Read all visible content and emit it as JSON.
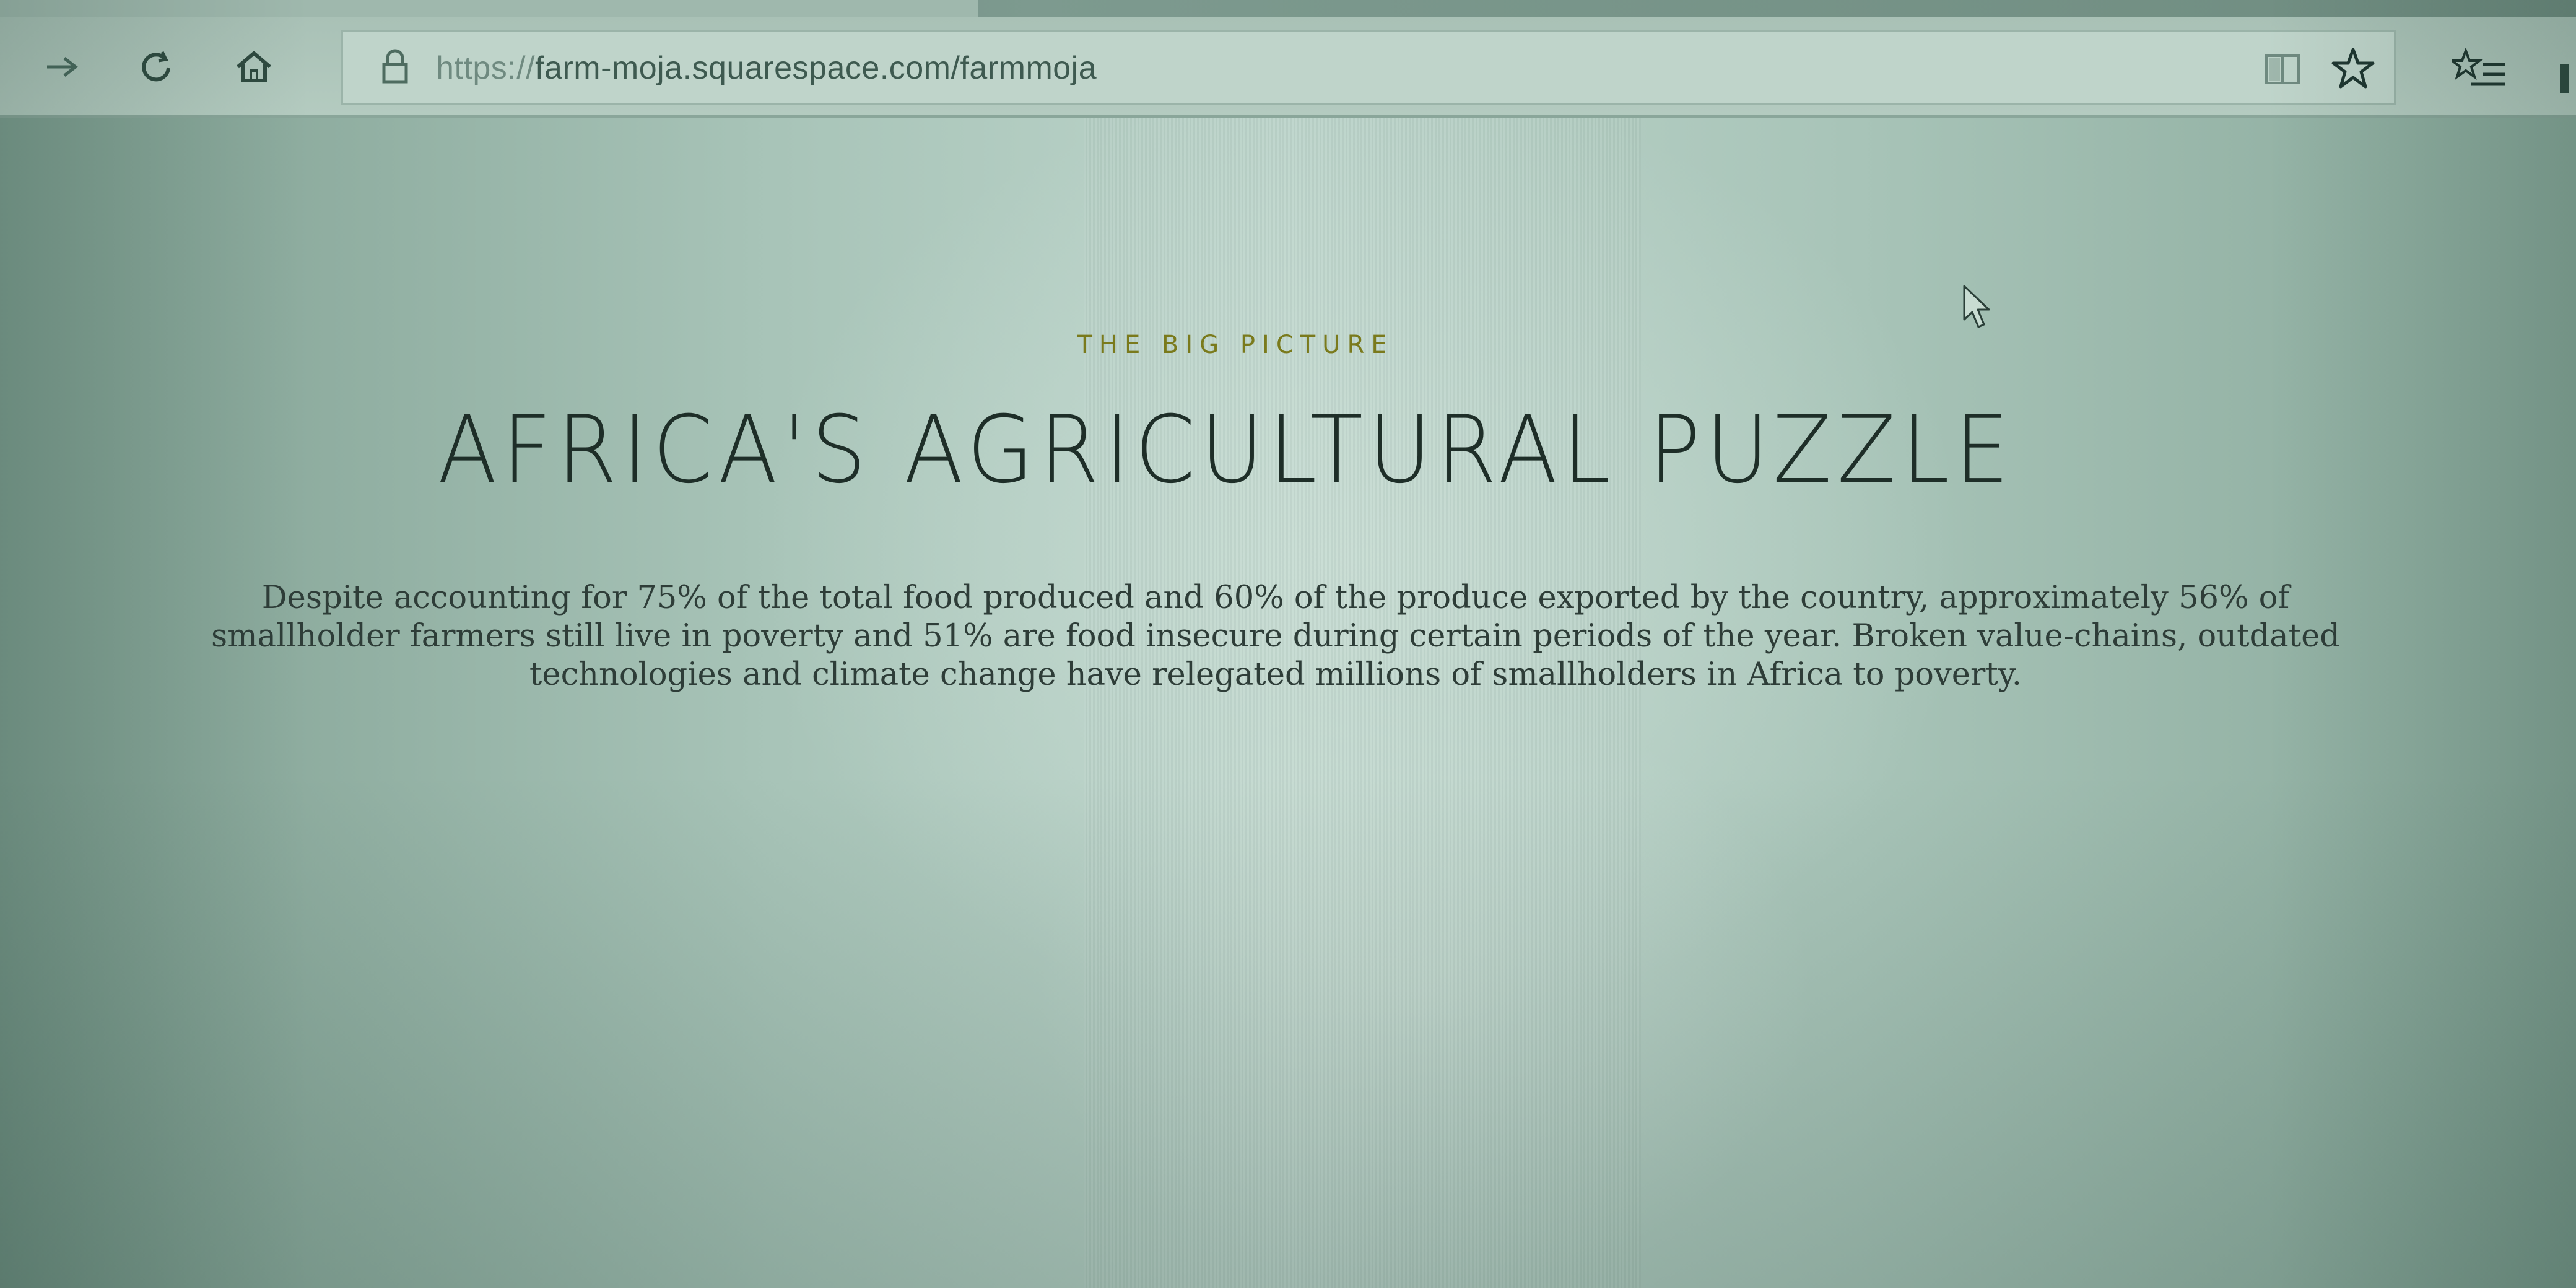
{
  "browser": {
    "url_scheme": "https://",
    "url_rest": "farm-moja.squarespace.com/farmmoja",
    "icons": {
      "forward": "forward-arrow-icon",
      "refresh": "refresh-icon",
      "home": "home-icon",
      "lock": "lock-icon",
      "reading_view": "reading-view-icon",
      "favorite": "star-icon",
      "favorites_hub": "favorites-hub-icon"
    }
  },
  "page": {
    "eyebrow": "THE BIG PICTURE",
    "headline": "AFRICA'S AGRICULTURAL PUZZLE",
    "body_line1": "Despite accounting for 75% of the total food produced and 60% of the produce exported by the country, approximately 56% of",
    "body_line2": "smallholder farmers still live in poverty and 51% are food insecure during certain periods of the year. Broken value-chains, outdated",
    "body_line3": "technologies and climate change have relegated millions of smallholders in Africa to poverty."
  },
  "colors": {
    "eyebrow": "#7a7a1c",
    "headline": "#1e2e28",
    "body": "#2e3d38",
    "screen_tint": "#a8c4b8"
  }
}
